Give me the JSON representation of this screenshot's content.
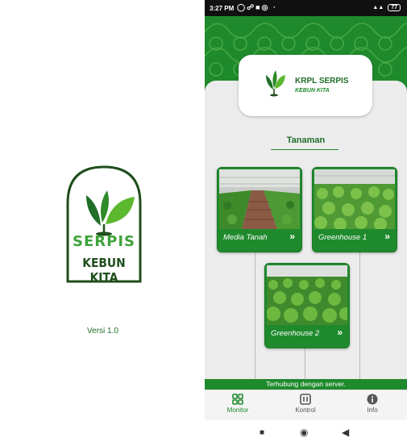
{
  "splash": {
    "logo_word1": "SERPIS",
    "logo_word2": "KEBUN KITA",
    "version": "Versi 1.0"
  },
  "statusbar": {
    "time": "3:27 PM",
    "battery": "77"
  },
  "header": {
    "title": "KRPL SERPIS",
    "subtitle": "KEBUN KITA"
  },
  "section": {
    "title": "Tanaman"
  },
  "cards": [
    {
      "label": "Media Tanah"
    },
    {
      "label": "Greenhouse 1"
    },
    {
      "label": "Greenhouse 2"
    }
  ],
  "connection_status": "Terhubung dengan server.",
  "bottom_nav": [
    {
      "label": "Monitor",
      "icon": "grid-icon"
    },
    {
      "label": "Kontrol",
      "icon": "control-icon"
    },
    {
      "label": "Info",
      "icon": "info-icon"
    }
  ],
  "colors": {
    "primary": "#1f8a2c",
    "dark": "#1f6e29",
    "accent": "#3ea33a"
  }
}
